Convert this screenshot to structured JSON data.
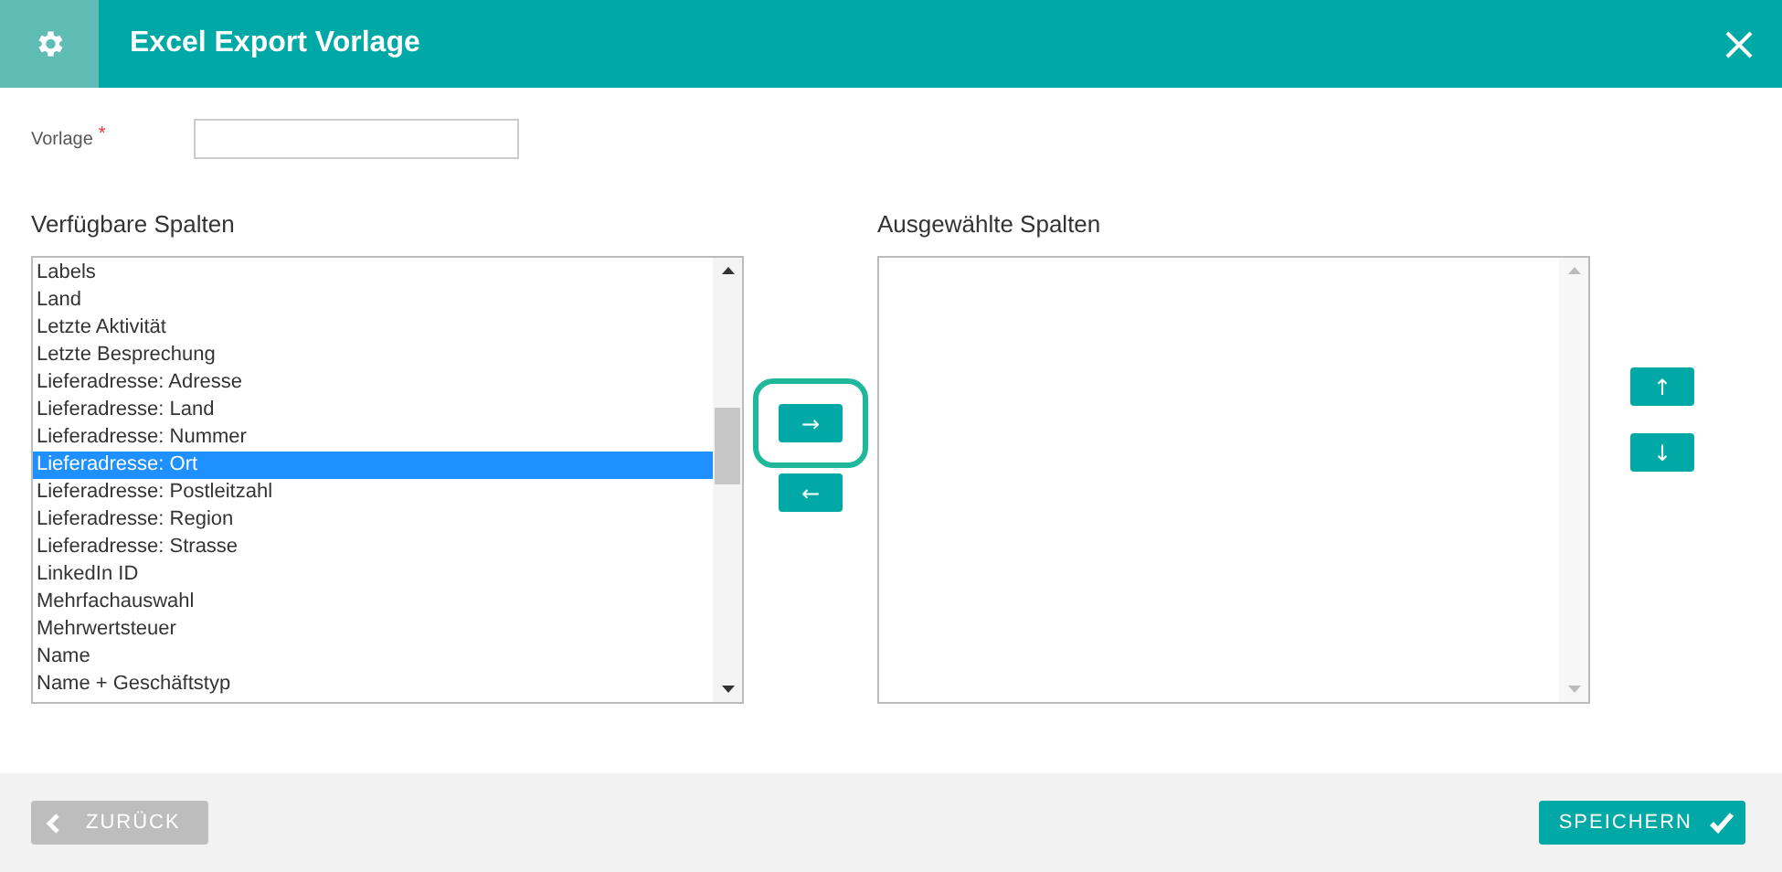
{
  "window": {
    "title": "Excel Export Vorlage"
  },
  "form": {
    "label": "Vorlage",
    "required_mark": "*"
  },
  "available": {
    "heading": "Verfügbare Spalten",
    "items": [
      {
        "label": "Labels",
        "selected": false
      },
      {
        "label": "Land",
        "selected": false
      },
      {
        "label": "Letzte Aktivität",
        "selected": false
      },
      {
        "label": "Letzte Besprechung",
        "selected": false
      },
      {
        "label": "Lieferadresse: Adresse",
        "selected": false
      },
      {
        "label": "Lieferadresse: Land",
        "selected": false
      },
      {
        "label": "Lieferadresse: Nummer",
        "selected": false
      },
      {
        "label": "Lieferadresse: Ort",
        "selected": true
      },
      {
        "label": "Lieferadresse: Postleitzahl",
        "selected": false
      },
      {
        "label": "Lieferadresse: Region",
        "selected": false
      },
      {
        "label": "Lieferadresse: Strasse",
        "selected": false
      },
      {
        "label": "LinkedIn ID",
        "selected": false
      },
      {
        "label": "Mehrfachauswahl",
        "selected": false
      },
      {
        "label": "Mehrwertsteuer",
        "selected": false
      },
      {
        "label": "Name",
        "selected": false
      },
      {
        "label": "Name + Geschäftstyp",
        "selected": false
      }
    ]
  },
  "transfer_buttons": [
    {
      "label": "→",
      "highlighted": true
    },
    {
      "label": "←",
      "highlighted": false
    }
  ],
  "selected_columns": {
    "heading": "Ausgewählte Spalten"
  },
  "order_buttons": [
    {
      "label": "↑"
    },
    {
      "label": "↓"
    }
  ],
  "footer": {
    "back": {
      "label": "ZURÜCK",
      "disabled": true
    },
    "save": {
      "label": "SPEICHERN"
    }
  }
}
